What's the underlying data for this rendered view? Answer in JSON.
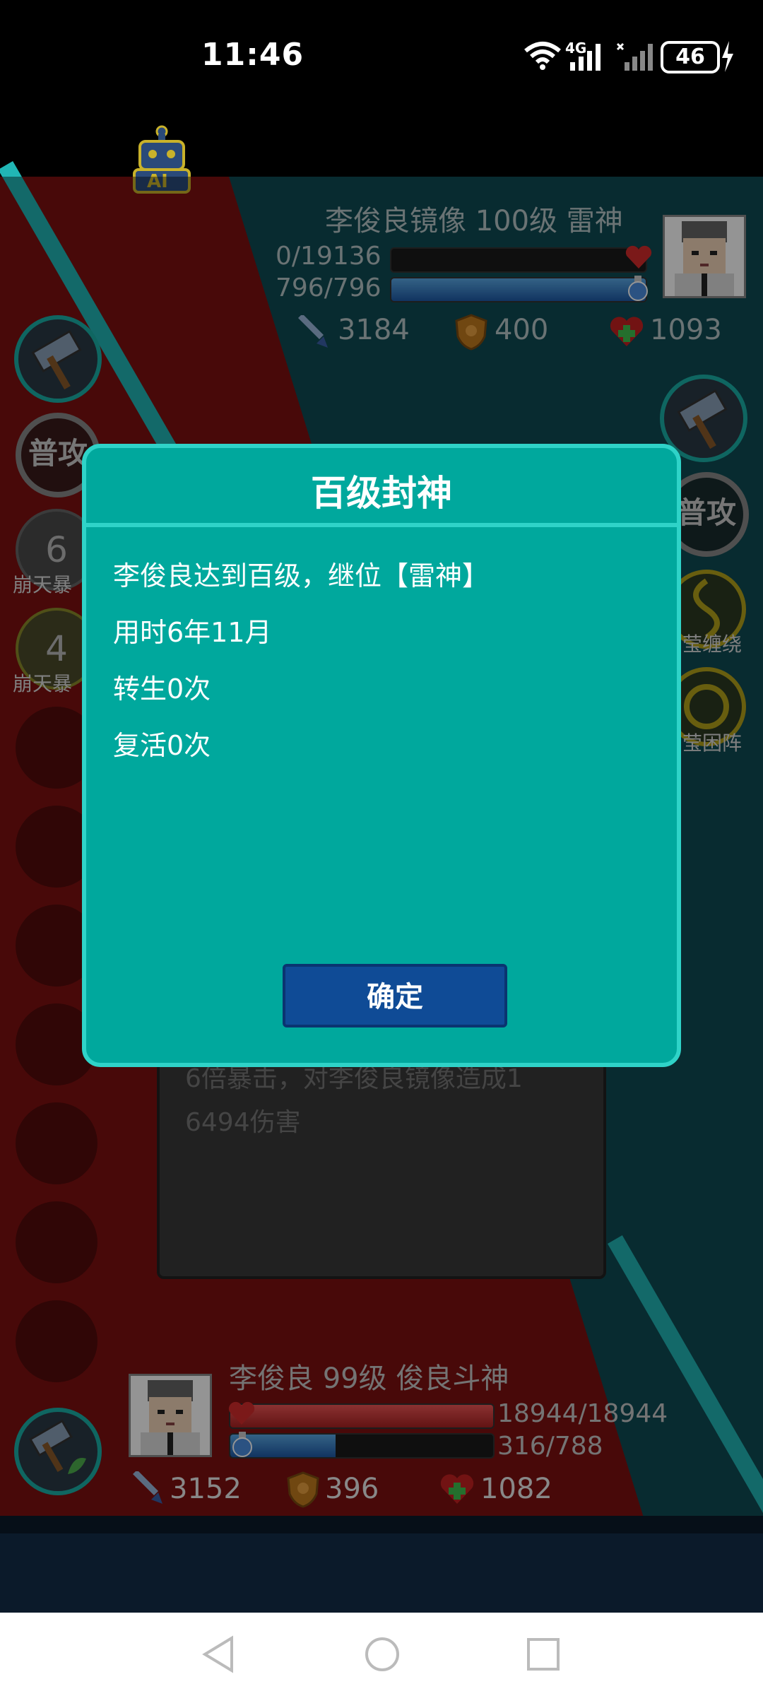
{
  "status_bar": {
    "time": "11:46",
    "signal1_label": "4G",
    "battery": "46"
  },
  "enemy": {
    "name_line": "李俊良镜像 100级 雷神",
    "hp_text": "0/19136",
    "mp_text": "796/796",
    "hp_fraction": 0,
    "mp_fraction": 1.0,
    "attack": "3184",
    "defense": "400",
    "health": "1093"
  },
  "enemy_skills": {
    "attack_label": "普攻",
    "skill1_label": "莹缠绕",
    "skill2_label": "莹困阵"
  },
  "left_skills": {
    "attack_label": "普攻",
    "skill1_count": "6",
    "skill1_label": "崩天暴",
    "skill2_count": "4",
    "skill2_label": "崩天暴"
  },
  "player": {
    "name_line": "李俊良 99级 俊良斗神",
    "hp_text": "18944/18944",
    "mp_text": "316/788",
    "hp_fraction": 1.0,
    "mp_fraction": 0.401,
    "attack": "3152",
    "defense": "396",
    "health": "1082"
  },
  "ai_badge": "AI",
  "log": {
    "line1": "6倍暴击，对李俊良镜像造成1",
    "line2": "6494伤害"
  },
  "dialog": {
    "title": "百级封神",
    "line1": "李俊良达到百级，继位【雷神】",
    "line2": "用时6年11月",
    "line3": "转生0次",
    "line4": "复活0次",
    "confirm": "确定"
  },
  "colors": {
    "dialog_bg": "#00a89d",
    "dialog_border": "#2fd3c8",
    "button_bg": "#0f4b96",
    "enemy_zone": "#0f4a53",
    "player_zone": "#7d1111"
  }
}
